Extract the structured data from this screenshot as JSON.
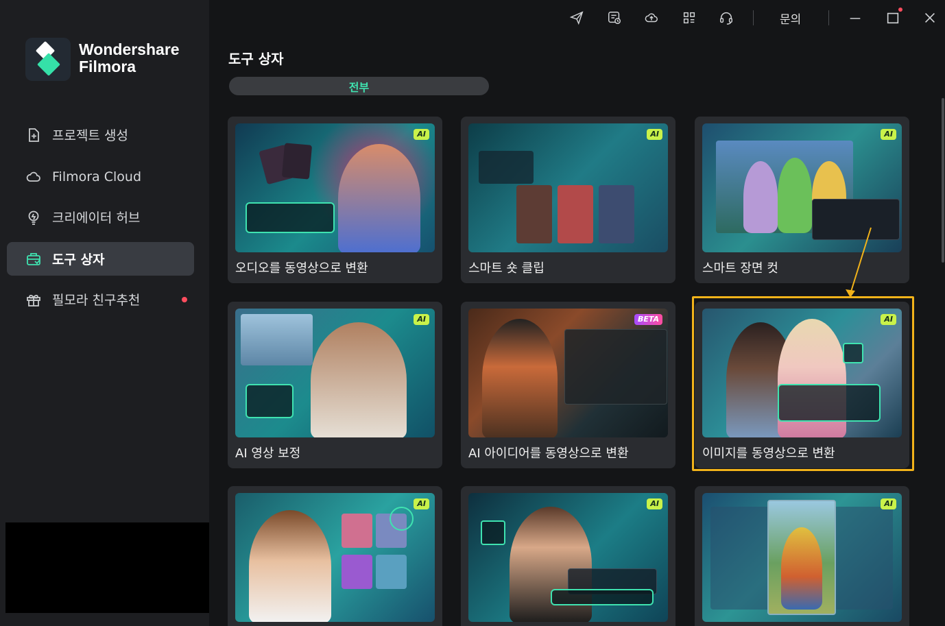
{
  "app": {
    "brand_line1": "Wondershare",
    "brand_line2": "Filmora",
    "accent_color": "#3fe3b0",
    "highlight_color": "#f2b31a"
  },
  "sidebar": {
    "items": [
      {
        "label": "프로젝트 생성",
        "icon": "add-file-icon",
        "active": false
      },
      {
        "label": "Filmora Cloud",
        "icon": "cloud-icon",
        "active": false
      },
      {
        "label": "크리에이터 허브",
        "icon": "lightbulb-icon",
        "active": false
      },
      {
        "label": "도구 상자",
        "icon": "toolbox-icon",
        "active": true
      },
      {
        "label": "필모라 친구추천",
        "icon": "gift-icon",
        "active": false,
        "notification_dot": true
      }
    ]
  },
  "titlebar": {
    "icons": [
      "send-icon",
      "tasks-icon",
      "cloud-upload-icon",
      "grid-icon",
      "headset-icon"
    ],
    "inquiry_label": "문의",
    "window_controls": [
      "minimize-icon",
      "maximize-icon",
      "close-icon"
    ]
  },
  "main": {
    "title": "도구 상자",
    "tabs": [
      {
        "label": "전부",
        "active": true
      }
    ],
    "cards": [
      {
        "label": "오디오를 동영상으로 변환",
        "badge": "AI"
      },
      {
        "label": "스마트 숏 클립",
        "badge": "AI"
      },
      {
        "label": "스마트 장면 컷",
        "badge": "AI"
      },
      {
        "label": "AI 영상 보정",
        "badge": "AI"
      },
      {
        "label": "AI 아이디어를 동영상으로 변환",
        "badge": "BETA"
      },
      {
        "label": "이미지를 동영상으로 변환",
        "badge": "AI",
        "highlighted": true
      },
      {
        "label": "",
        "badge": "AI"
      },
      {
        "label": "",
        "badge": "AI"
      },
      {
        "label": "",
        "badge": "AI"
      }
    ]
  }
}
